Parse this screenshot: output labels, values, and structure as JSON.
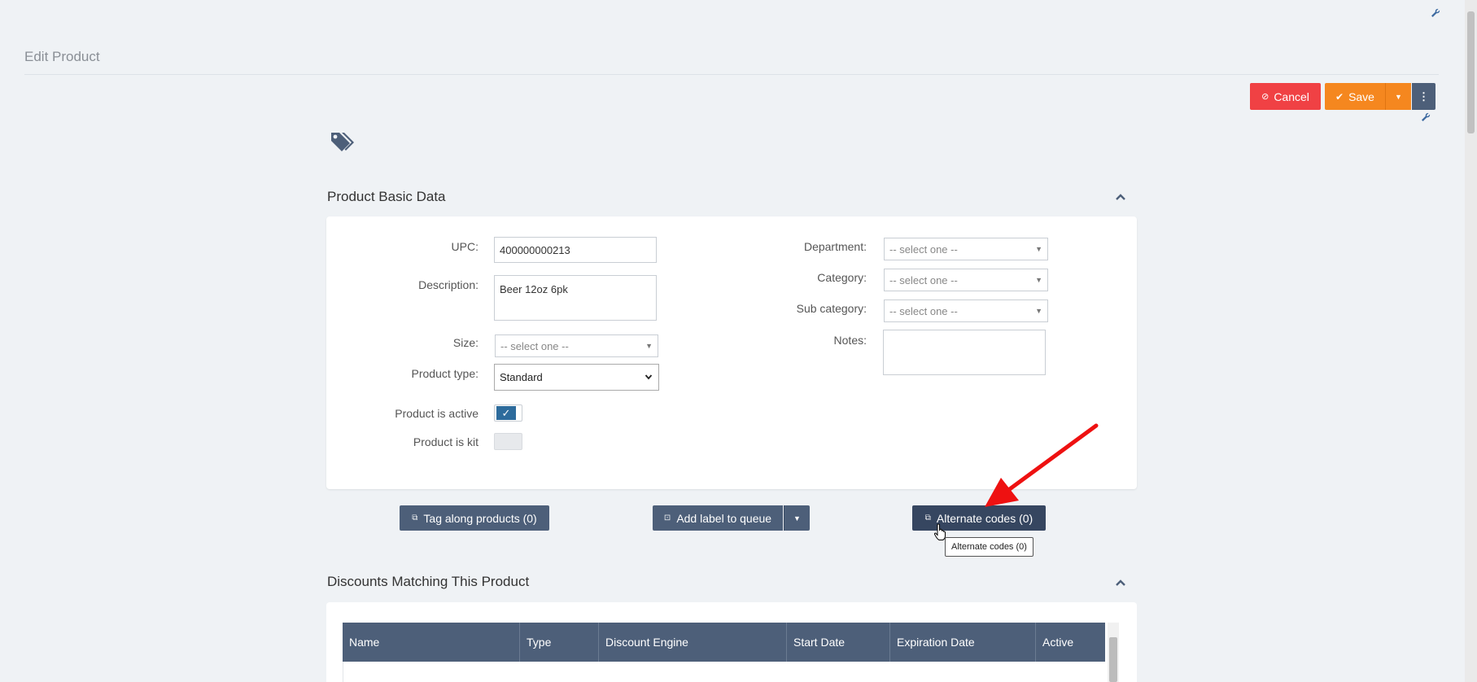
{
  "header": {
    "title": "Edit Product"
  },
  "actions": {
    "cancel_label": "Cancel",
    "save_label": "Save"
  },
  "basic": {
    "section_title": "Product Basic Data",
    "upc": {
      "label": "UPC:",
      "value": "400000000213"
    },
    "description": {
      "label": "Description:",
      "value": "Beer 12oz 6pk"
    },
    "size": {
      "label": "Size:",
      "placeholder": "-- select one --"
    },
    "product_type": {
      "label": "Product type:",
      "value": "Standard"
    },
    "active": {
      "label": "Product is active",
      "checked": true
    },
    "kit": {
      "label": "Product is kit",
      "checked": false
    },
    "department": {
      "label": "Department:",
      "placeholder": "-- select one --"
    },
    "category": {
      "label": "Category:",
      "placeholder": "-- select one --"
    },
    "subcategory": {
      "label": "Sub category:",
      "placeholder": "-- select one --"
    },
    "notes": {
      "label": "Notes:",
      "value": ""
    }
  },
  "buttons": {
    "tag_along": "Tag along products (0)",
    "add_label": "Add label to queue",
    "alternate_codes": "Alternate codes (0)"
  },
  "tooltip": "Alternate codes (0)",
  "discounts": {
    "section_title": "Discounts Matching This Product",
    "columns": [
      "Name",
      "Type",
      "Discount Engine",
      "Start Date",
      "Expiration Date",
      "Active"
    ]
  },
  "colors": {
    "accent_dark": "#4d5f79",
    "cancel": "#f04144",
    "save": "#f5871f",
    "annotation_arrow": "#ee1111"
  }
}
